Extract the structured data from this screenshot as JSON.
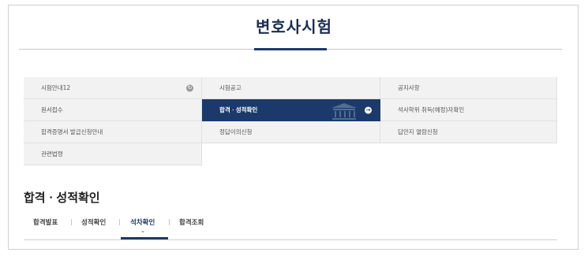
{
  "header": {
    "title": "변호사시험"
  },
  "menu": {
    "items": [
      {
        "label": "시험안내12",
        "icon": "refresh-icon"
      },
      {
        "label": "시험공고"
      },
      {
        "label": "공지사항"
      },
      {
        "label": "원서접수"
      },
      {
        "label": "합격ㆍ성적확인",
        "active": true,
        "icon": "arrow-right-icon"
      },
      {
        "label": "석사학위 취득(예정)자확인"
      },
      {
        "label": "합격증명서 발급신청안내"
      },
      {
        "label": "정답이의신청"
      },
      {
        "label": "답안지 열람신청"
      },
      {
        "label": "관련법령"
      }
    ],
    "accent_color": "#1b3a6b"
  },
  "section": {
    "title": "합격ㆍ성적확인",
    "tabs": [
      {
        "label": "합격발표"
      },
      {
        "label": "성적확인"
      },
      {
        "label": "석차확인",
        "active": true
      },
      {
        "label": "합격조회"
      }
    ]
  }
}
